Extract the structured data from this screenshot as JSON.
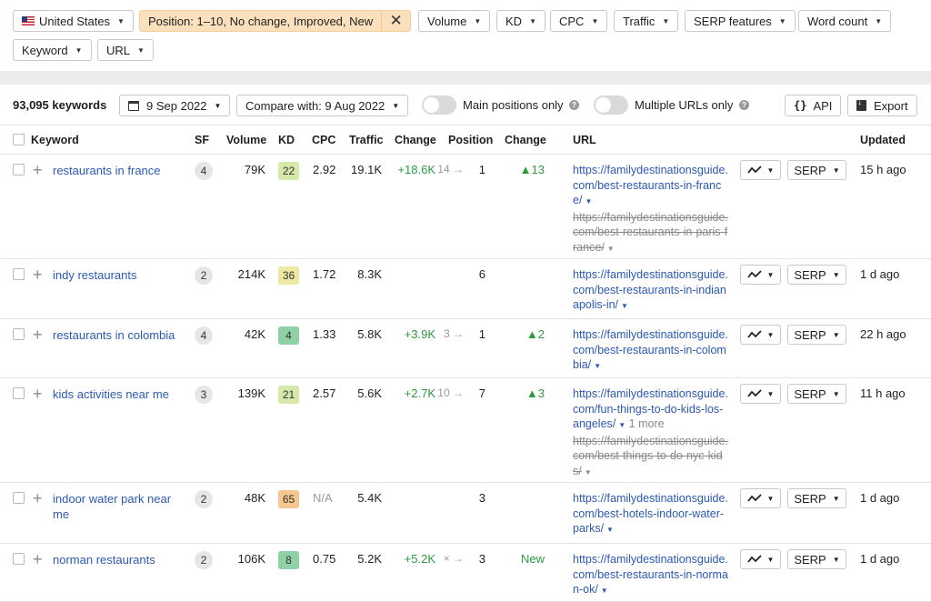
{
  "filters": {
    "country": "United States",
    "position": "Position: 1–10, No change, Improved, New",
    "volume": "Volume",
    "kd": "KD",
    "cpc": "CPC",
    "traffic": "Traffic",
    "serp_features": "SERP features",
    "word_count": "Word count",
    "keyword": "Keyword",
    "url": "URL"
  },
  "toolbar": {
    "count": "93,095 keywords",
    "date": "9 Sep 2022",
    "compare": "Compare with: 9 Aug 2022",
    "main_positions": "Main positions only",
    "multiple_urls": "Multiple URLs only",
    "api": "API",
    "export": "Export",
    "api_glyph": "{}"
  },
  "table": {
    "headers": {
      "keyword": "Keyword",
      "sf": "SF",
      "volume": "Volume",
      "kd": "KD",
      "cpc": "CPC",
      "traffic": "Traffic",
      "change": "Change",
      "position": "Position",
      "pos_change": "Change",
      "url": "URL",
      "updated": "Updated"
    },
    "serp_label": "SERP",
    "rows": [
      {
        "keyword": "restaurants in france",
        "sf": "4",
        "volume": "79K",
        "kd": "22",
        "kd_color": "#d6e9a8",
        "cpc": "2.92",
        "traffic": "19.1K",
        "change": "+18.6K",
        "pos_from": "14",
        "pos_arrow": "→",
        "pos_to": "1",
        "pos_change": "▲13",
        "url": "https://familydestinationsguide.com/best-restaurants-in-france/",
        "url_old": "https://familydestinationsguide.com/best-restaurants-in-paris-france/",
        "url_more": "",
        "updated": "15 h ago"
      },
      {
        "keyword": "indy restaurants",
        "sf": "2",
        "volume": "214K",
        "kd": "36",
        "kd_color": "#ece9a2",
        "cpc": "1.72",
        "traffic": "8.3K",
        "change": "",
        "pos_from": "",
        "pos_arrow": "",
        "pos_to": "6",
        "pos_change": "",
        "url": "https://familydestinationsguide.com/best-restaurants-in-indianapolis-in/",
        "url_old": "",
        "url_more": "",
        "updated": "1 d ago"
      },
      {
        "keyword": "restaurants in colombia",
        "sf": "4",
        "volume": "42K",
        "kd": "4",
        "kd_color": "#8fd1a6",
        "cpc": "1.33",
        "traffic": "5.8K",
        "change": "+3.9K",
        "pos_from": "3",
        "pos_arrow": "→",
        "pos_to": "1",
        "pos_change": "▲2",
        "url": "https://familydestinationsguide.com/best-restaurants-in-colombia/",
        "url_old": "",
        "url_more": "",
        "updated": "22 h ago"
      },
      {
        "keyword": "kids activities near me",
        "sf": "3",
        "volume": "139K",
        "kd": "21",
        "kd_color": "#d6e9a8",
        "cpc": "2.57",
        "traffic": "5.6K",
        "change": "+2.7K",
        "pos_from": "10",
        "pos_arrow": "→",
        "pos_to": "7",
        "pos_change": "▲3",
        "url": "https://familydestinationsguide.com/fun-things-to-do-kids-los-angeles/",
        "url_old": "https://familydestinationsguide.com/best-things-to-do-nyc-kids/",
        "url_more": "1 more",
        "updated": "11 h ago"
      },
      {
        "keyword": "indoor water park near me",
        "sf": "2",
        "volume": "48K",
        "kd": "65",
        "kd_color": "#f6c68f",
        "cpc": "N/A",
        "traffic": "5.4K",
        "change": "",
        "pos_from": "",
        "pos_arrow": "",
        "pos_to": "3",
        "pos_change": "",
        "url": "https://familydestinationsguide.com/best-hotels-indoor-water-parks/",
        "url_old": "",
        "url_more": "",
        "updated": "1 d ago"
      },
      {
        "keyword": "norman restaurants",
        "sf": "2",
        "volume": "106K",
        "kd": "8",
        "kd_color": "#8fd1a6",
        "cpc": "0.75",
        "traffic": "5.2K",
        "change": "+5.2K",
        "pos_from": "×",
        "pos_arrow": "→",
        "pos_to": "3",
        "pos_change": "New",
        "url": "https://familydestinationsguide.com/best-restaurants-in-norman-ok/",
        "url_old": "",
        "url_more": "",
        "updated": "1 d ago"
      }
    ]
  }
}
